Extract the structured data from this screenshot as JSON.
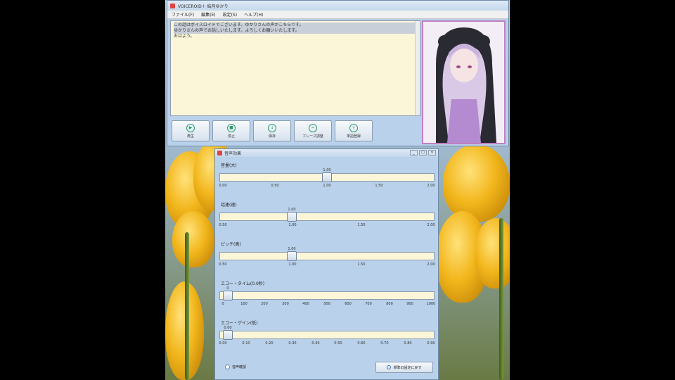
{
  "main_window": {
    "title": "VOICEROID＋ 結月ゆかり",
    "menu": [
      "ファイル(F)",
      "編集(E)",
      "設定(S)",
      "ヘルプ(H)"
    ],
    "text_lines": [
      "この話はボイスロイドでございます。ゆかりさんの声がこちらです。",
      "ゆかりさんの声でお話しいたします。よろしくお願いいたします。",
      "おはよう。"
    ],
    "buttons": [
      {
        "label": "再生",
        "icon": "play-icon"
      },
      {
        "label": "停止",
        "icon": "stop-icon"
      },
      {
        "label": "保存",
        "icon": "save-icon"
      },
      {
        "label": "フレーズ調整",
        "icon": "phrase-icon"
      },
      {
        "label": "単語登録",
        "icon": "word-icon"
      }
    ]
  },
  "sound_window": {
    "title": "音声効果",
    "controls": [
      "_",
      "□",
      "×"
    ],
    "sliders": [
      {
        "label": "音量(大)",
        "value": "1.00",
        "fraction": 0.5,
        "ticks": [
          "0.00",
          "0.50",
          "1.00",
          "1.50",
          "2.00"
        ]
      },
      {
        "label": "話速(速)",
        "value": "1.00",
        "fraction": 0.333,
        "ticks": [
          "0.50",
          "1.00",
          "1.50",
          "2.00"
        ]
      },
      {
        "label": "ピッチ(高)",
        "value": "1.00",
        "fraction": 0.333,
        "ticks": [
          "0.50",
          "1.00",
          "1.50",
          "2.00"
        ]
      },
      {
        "label": "エコー・タイム(0.0秒)",
        "value": "0",
        "fraction": 0.03,
        "ticks": [
          "0",
          "100",
          "200",
          "300",
          "400",
          "500",
          "600",
          "700",
          "800",
          "900",
          "1000"
        ]
      },
      {
        "label": "エコー・ゲイン(低)",
        "value": "0.00",
        "fraction": 0.03,
        "ticks": [
          "0.00",
          "0.10",
          "0.20",
          "0.30",
          "0.40",
          "0.50",
          "0.60",
          "0.70",
          "0.80",
          "0.90"
        ]
      }
    ],
    "checkbox_label": "音声確認",
    "reset_label": "標準の設定に戻す"
  }
}
